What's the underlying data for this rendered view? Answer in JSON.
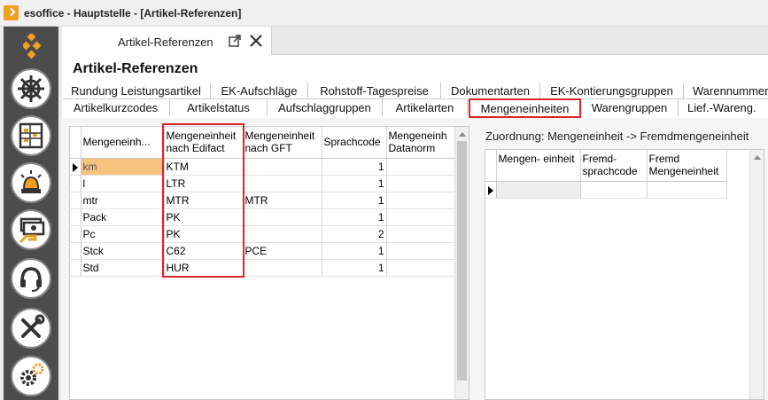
{
  "window": {
    "title": "esoffice - Hauptstelle - [Artikel-Referenzen]"
  },
  "document_tab": {
    "label": "Artikel-Referenzen"
  },
  "page_title": "Artikel-Referenzen",
  "tabs_row1": [
    "Rundung Leistungsartikel",
    "EK-Aufschläge",
    "Rohstoff-Tagespreise",
    "Dokumentarten",
    "EK-Kontierungsgruppen",
    "Warennummer"
  ],
  "tabs_row2": [
    "Artikelkurzcodes",
    "Artikelstatus",
    "Aufschlaggruppen",
    "Artikelarten",
    "Mengeneinheiten",
    "Warengruppen",
    "Lief.-Wareng."
  ],
  "active_tab": "Mengeneinheiten",
  "main_grid": {
    "headers": [
      "Mengeneinh...",
      "Mengeneinheit nach Edifact",
      "Mengeneinheit nach GFT",
      "Sprachcode",
      "Mengeneinh Datanorm"
    ],
    "rows": [
      [
        "km",
        "KTM",
        "",
        "1",
        ""
      ],
      [
        "l",
        "LTR",
        "",
        "1",
        ""
      ],
      [
        "mtr",
        "MTR",
        "MTR",
        "1",
        ""
      ],
      [
        "Pack",
        "PK",
        "",
        "1",
        ""
      ],
      [
        "Pc",
        "PK",
        "",
        "2",
        ""
      ],
      [
        "Stck",
        "C62",
        "PCE",
        "1",
        ""
      ],
      [
        "Std",
        "HUR",
        "",
        "1",
        ""
      ]
    ]
  },
  "assoc": {
    "label": "Zuordnung: Mengeneinheit -> Fremdmengeneinheit",
    "headers": [
      "Mengen- einheit",
      "Fremd- sprachcode",
      "Fremd Mengeneinheit"
    ]
  },
  "colors": {
    "highlight": "#d9262b",
    "selected_cell": "#f6c27e",
    "sidebar": "#4c4c4c",
    "logo": "#f0a020"
  }
}
